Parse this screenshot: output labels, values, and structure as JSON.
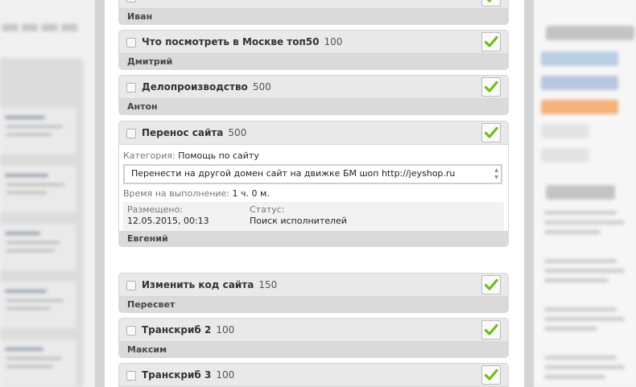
{
  "tasks": [
    {
      "title": "",
      "price": "",
      "author": "Иван"
    },
    {
      "title": "Что посмотреть в Москве топ50",
      "price": "100",
      "author": "Дмитрий"
    },
    {
      "title": "Делопроизводство",
      "price": "500",
      "author": "Антон"
    },
    {
      "title": "Перенос сайта",
      "price": "500",
      "author": "Евгений",
      "category_label": "Категория:",
      "category": "Помощь по сайту",
      "description": "Перенести на другой домен сайт на движке БМ шоп http://jeyshop.ru",
      "time_label": "Время на выполнение:",
      "time": "1 ч. 0 м.",
      "posted_label": "Размещено:",
      "posted": "12.05.2015, 00:13",
      "status_label": "Статус:",
      "status": "Поиск исполнителей"
    },
    {
      "title": "Изменить код сайта",
      "price": "150",
      "author": "Пересвет"
    },
    {
      "title": "Транскриб 2",
      "price": "100",
      "author": "Максим"
    },
    {
      "title": "Транскриб 3",
      "price": "100",
      "author": ""
    }
  ],
  "colors": {
    "check": "#6cbf1d",
    "header": "#e9e9e9",
    "author_bar": "#dadada"
  },
  "icons": {
    "approve": "green-check-icon"
  }
}
